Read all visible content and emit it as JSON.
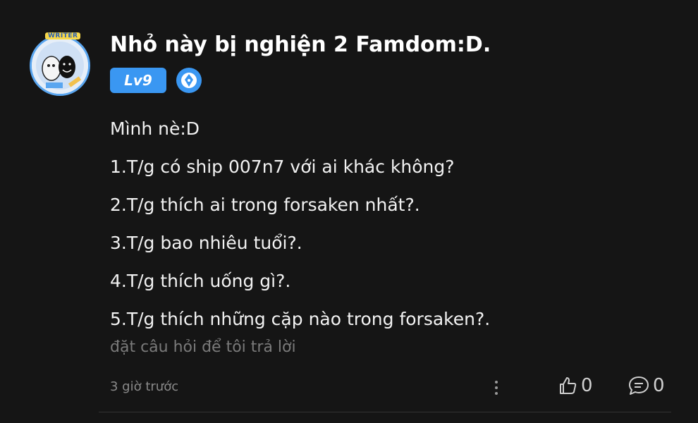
{
  "post": {
    "title": "Nhỏ này bị nghiện 2 Famdom:D.",
    "avatar_label": "WRITER",
    "level_badge": "Lv9",
    "lines": [
      "Mình nè:D",
      "1.T/g có ship 007n7 với ai khác không?",
      "2.T/g thích ai trong forsaken nhất?.",
      "3.T/g bao nhiêu tuổi?.",
      "4.T/g thích uống gì?.",
      "5.T/g thích những cặp nào trong forsaken?."
    ],
    "question_prompt": "đặt câu hỏi để tôi trả lời",
    "timestamp": "3 giờ trước",
    "like_count": "0",
    "comment_count": "0"
  },
  "colors": {
    "background": "#151515",
    "accent": "#3a97f2",
    "muted_text": "#7a7a7a"
  },
  "icons": [
    "writer-avatar",
    "pen-nib-icon",
    "more-options-icon",
    "thumbs-up-icon",
    "comment-icon"
  ]
}
